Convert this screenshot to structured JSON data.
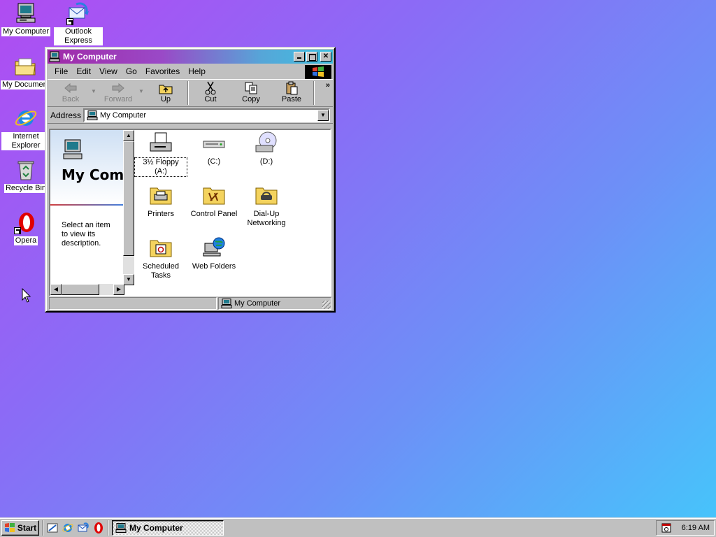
{
  "desktop": {
    "icons": [
      {
        "label": "My Computer",
        "icon": "my-computer-icon"
      },
      {
        "label": "Outlook Express",
        "icon": "outlook-express-icon"
      },
      {
        "label": "My Documents",
        "icon": "my-documents-folder-icon"
      },
      {
        "label": "Internet Explorer",
        "icon": "internet-explorer-icon"
      },
      {
        "label": "Recycle Bin",
        "icon": "recycle-bin-icon"
      },
      {
        "label": "Opera",
        "icon": "opera-icon"
      }
    ]
  },
  "window": {
    "title": "My Computer",
    "menu": [
      "File",
      "Edit",
      "View",
      "Go",
      "Favorites",
      "Help"
    ],
    "menu_underlines": [
      "F",
      "E",
      "V",
      "G",
      "a",
      "H"
    ],
    "toolbar": {
      "back": "Back",
      "forward": "Forward",
      "up": "Up",
      "cut": "Cut",
      "copy": "Copy",
      "paste": "Paste",
      "more": "»"
    },
    "address": {
      "label": "Address",
      "value": "My Computer"
    },
    "left_pane": {
      "title": "My Computer",
      "description": "Select an item to view its description."
    },
    "items": [
      {
        "label": "3½ Floppy (A:)",
        "icon": "floppy-drive-icon",
        "selected": true
      },
      {
        "label": "(C:)",
        "icon": "hard-drive-icon",
        "selected": false
      },
      {
        "label": "(D:)",
        "icon": "cd-drive-icon",
        "selected": false
      },
      {
        "label": "Printers",
        "icon": "printers-folder-icon",
        "selected": false
      },
      {
        "label": "Control Panel",
        "icon": "control-panel-folder-icon",
        "selected": false
      },
      {
        "label": "Dial-Up Networking",
        "icon": "dialup-folder-icon",
        "selected": false
      },
      {
        "label": "Scheduled Tasks",
        "icon": "scheduled-tasks-folder-icon",
        "selected": false
      },
      {
        "label": "Web Folders",
        "icon": "web-folders-icon",
        "selected": false
      }
    ],
    "status": {
      "text": "My Computer"
    }
  },
  "taskbar": {
    "start_label": "Start",
    "quick_launch": [
      "show-desktop-icon",
      "internet-explorer-icon",
      "outlook-express-icon",
      "opera-icon"
    ],
    "task_button": "My Computer",
    "clock": "6:19 AM",
    "tray_icon": "scheduler-tray-icon"
  },
  "colors": {
    "desktop_gradient_start": "#b04cf2",
    "desktop_gradient_end": "#45c6fb",
    "title_gradient_start": "#a02aa8",
    "title_gradient_end": "#3fbfe0",
    "face": "#c0c0c0"
  }
}
